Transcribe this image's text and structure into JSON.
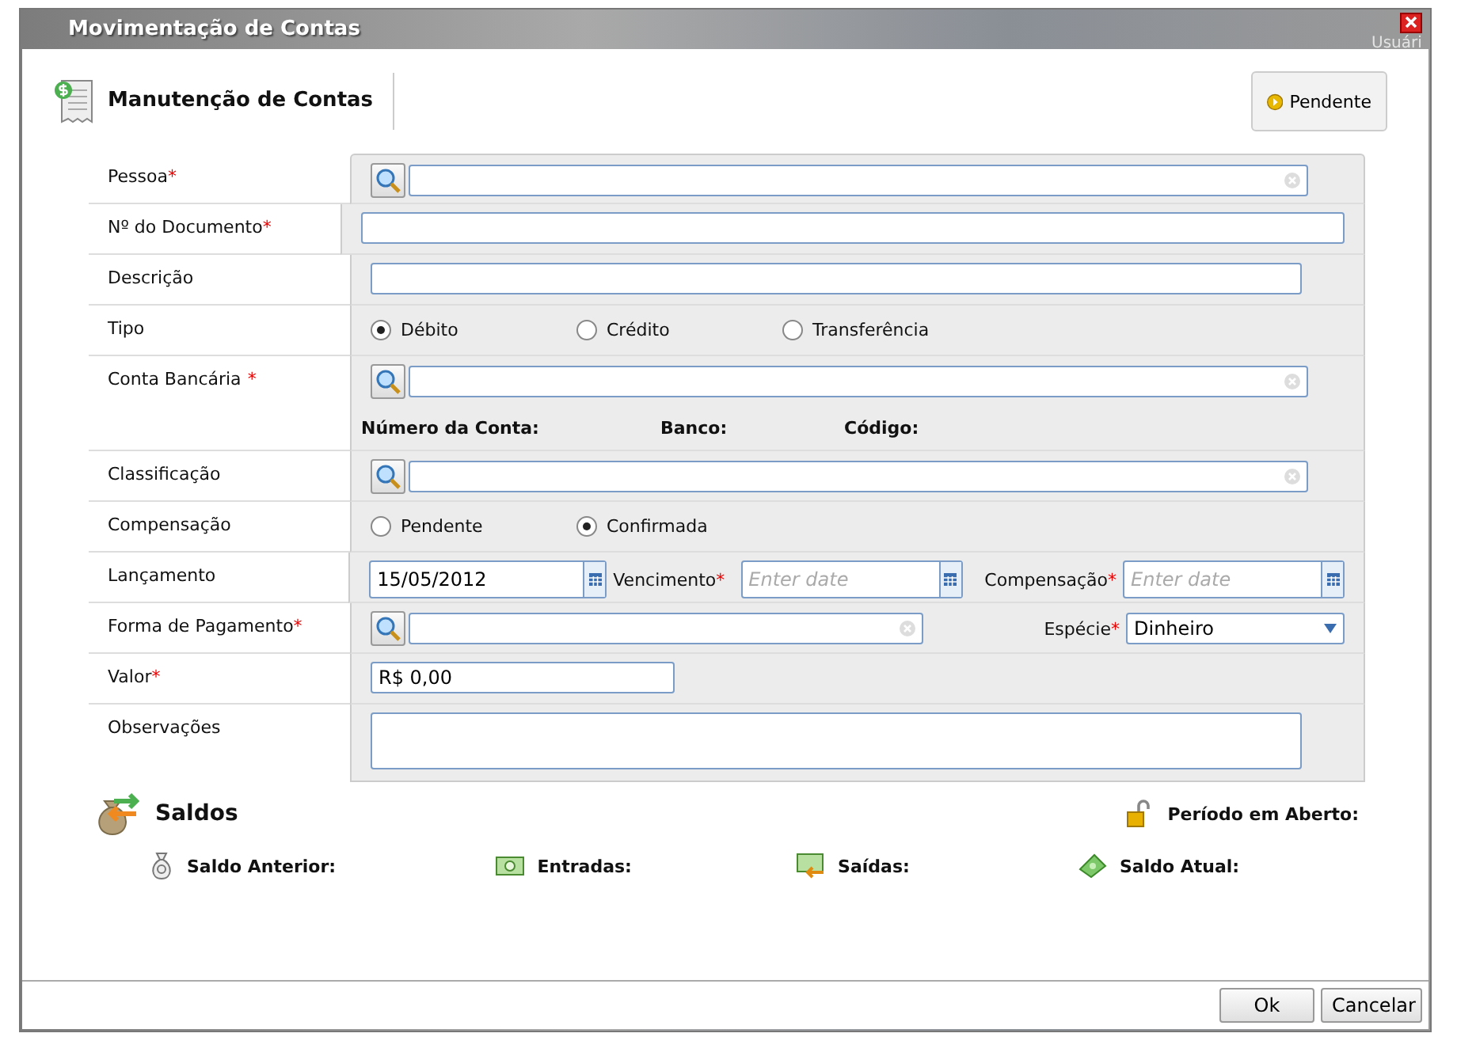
{
  "background": {
    "tab": "Usuári"
  },
  "window": {
    "title": "Movimentação de Contas"
  },
  "header": {
    "title": "Manutenção de Contas",
    "status_button": "Pendente"
  },
  "form": [
    {
      "kind": "lookup",
      "label": "Pessoa",
      "marker": "*"
    },
    {
      "kind": "wide_text",
      "label": "Nº do Documento",
      "marker": "*"
    },
    {
      "kind": "text",
      "label": "Descrição"
    },
    {
      "kind": "radio",
      "label": "Tipo",
      "options": [
        {
          "label": "Débito",
          "selected": true
        },
        {
          "label": "Crédito",
          "selected": false
        },
        {
          "label": "Transferência",
          "selected": false
        }
      ]
    },
    {
      "kind": "account",
      "label": "Conta Bancária",
      "marker": "*",
      "details": [
        "Número da Conta:",
        "Banco:",
        "Código:"
      ]
    },
    {
      "kind": "lookup",
      "label": "Classificação"
    },
    {
      "kind": "radio",
      "label": "Compensação",
      "options": [
        {
          "label": "Pendente",
          "selected": false
        },
        {
          "label": "Confirmada",
          "selected": true
        }
      ]
    },
    {
      "kind": "dates",
      "label": "Lançamento",
      "value": "15/05/2012",
      "extra": [
        {
          "label": "Vencimento",
          "marker": "*",
          "placeholder": "Enter date"
        },
        {
          "label": "Compensação",
          "marker": "*",
          "placeholder": "Enter date"
        }
      ]
    },
    {
      "kind": "payment",
      "label": "Forma de Pagamento",
      "marker": "*",
      "select": {
        "label": "Espécie",
        "marker": "*",
        "value": "Dinheiro"
      }
    },
    {
      "kind": "money",
      "label": "Valor",
      "marker": "*",
      "value": "R$ 0,00"
    },
    {
      "kind": "textarea",
      "label": "Observações"
    }
  ],
  "saldos": {
    "title": "Saldos",
    "period": "Período em Aberto:",
    "items": [
      {
        "kind": "bag",
        "label": "Saldo Anterior:"
      },
      {
        "kind": "in",
        "label": "Entradas:"
      },
      {
        "kind": "out",
        "label": "Saídas:"
      },
      {
        "kind": "cash",
        "label": "Saldo Atual:"
      }
    ]
  },
  "buttons": [
    "Ok",
    "Cancelar"
  ]
}
